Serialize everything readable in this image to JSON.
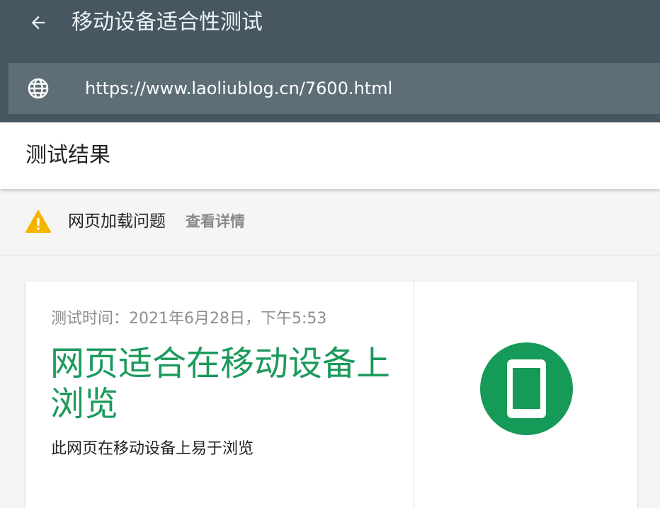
{
  "header": {
    "title": "移动设备适合性测试",
    "back_icon": "arrow-back-icon",
    "url_icon": "globe-icon",
    "url": "https://www.laoliublog.cn/7600.html",
    "colors": {
      "bar": "#465762",
      "url_field": "#5e6e77"
    }
  },
  "results": {
    "title": "测试结果",
    "issue": {
      "icon": "warning-icon",
      "label": "网页加载问题",
      "link": "查看详情",
      "color": "#f4b400"
    },
    "card": {
      "timestamp": "测试时间：2021年6月28日，下午5:53",
      "headline": "网页适合在移动设备上浏览",
      "description": "此网页在移动设备上易于浏览",
      "badge_icon": "mobile-phone-icon",
      "accent": "#1b9a5c"
    }
  }
}
